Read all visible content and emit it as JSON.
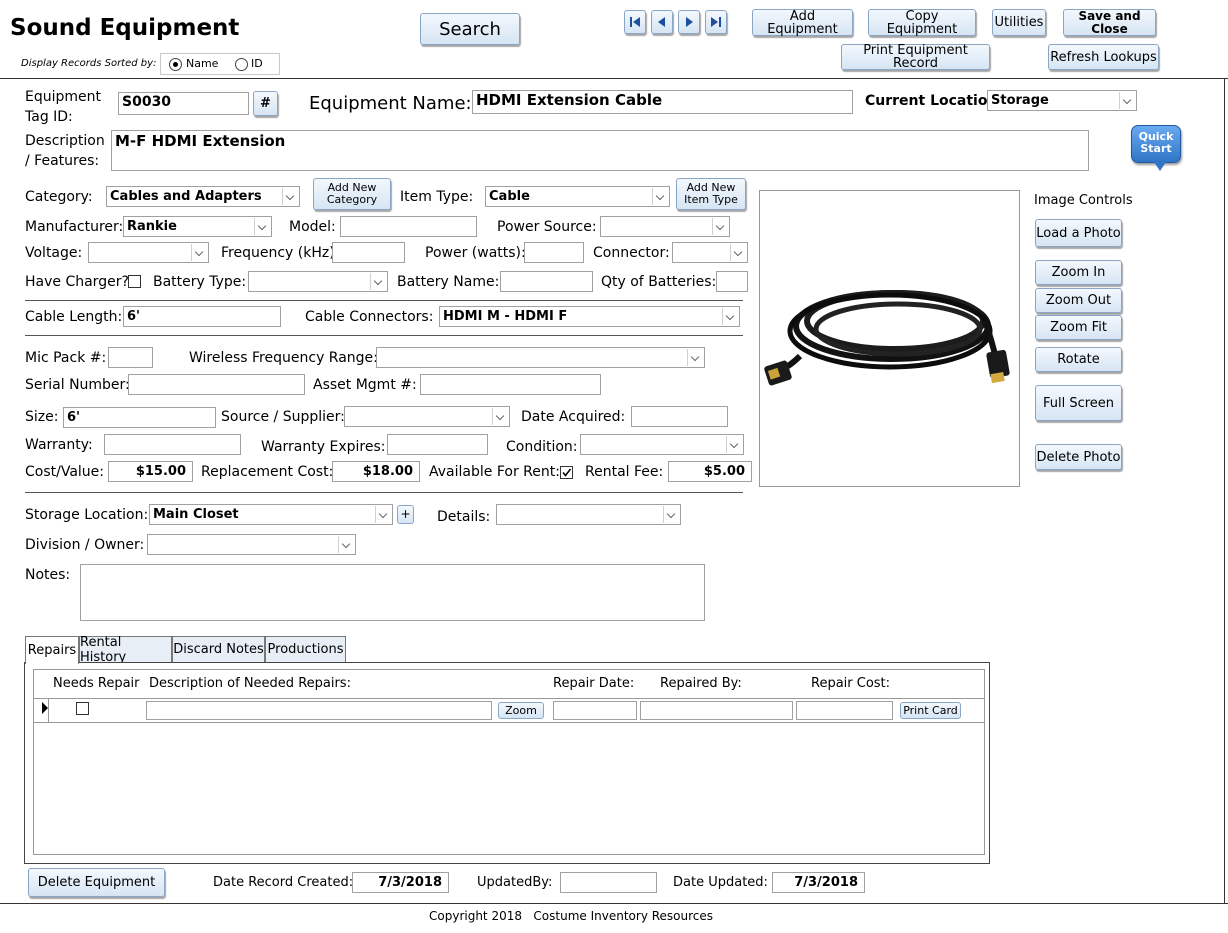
{
  "header": {
    "title": "Sound Equipment",
    "sort_label": "Display Records Sorted by:",
    "sort_options": [
      {
        "label": "Name",
        "selected": true
      },
      {
        "label": "ID",
        "selected": false
      }
    ],
    "search_label": "Search",
    "buttons": {
      "add_equipment": "Add Equipment",
      "copy_equipment": "Copy Equipment",
      "utilities": "Utilities",
      "save_close": "Save and Close",
      "print_record": "Print Equipment Record",
      "refresh_lookups": "Refresh Lookups"
    },
    "nav_icons": [
      "first-record-icon",
      "previous-record-icon",
      "next-record-icon",
      "last-record-icon"
    ]
  },
  "quick_start": {
    "line1": "Quick",
    "line2": "Start"
  },
  "record": {
    "tag_label_1": "Equipment",
    "tag_label_2": "Tag ID:",
    "tag_id": "S0030",
    "hash_label": "#",
    "name_label": "Equipment Name:",
    "name": "HDMI Extension Cable",
    "location_label": "Current Location:",
    "location": "Storage",
    "desc_label_1": "Description",
    "desc_label_2": "/ Features:",
    "description": "M-F HDMI Extension"
  },
  "details": {
    "category_label": "Category:",
    "category": "Cables and Adapters",
    "add_category_1": "Add New",
    "add_category_2": "Category",
    "item_type_label": "Item Type:",
    "item_type": "Cable",
    "add_item_type_1": "Add New",
    "add_item_type_2": "Item Type",
    "manufacturer_label": "Manufacturer:",
    "manufacturer": "Rankie",
    "model_label": "Model:",
    "model": "",
    "power_source_label": "Power Source:",
    "power_source": "",
    "voltage_label": "Voltage:",
    "voltage": "",
    "frequency_label": "Frequency (kHz):",
    "frequency": "",
    "power_label": "Power (watts):",
    "power": "",
    "connector_label": "Connector:",
    "connector": "",
    "charger_label": "Have Charger?",
    "battery_type_label": "Battery Type:",
    "battery_type": "",
    "battery_name_label": "Battery Name:",
    "battery_name": "",
    "qty_batteries_label": "Qty of Batteries:",
    "qty_batteries": "",
    "cable_length_label": "Cable Length:",
    "cable_length": "6'",
    "cable_connectors_label": "Cable Connectors:",
    "cable_connectors": "HDMI M - HDMI F",
    "mic_pack_label": "Mic Pack #:",
    "mic_pack": "",
    "wireless_label": "Wireless Frequency Range:",
    "wireless": "",
    "serial_label": "Serial Number:",
    "serial": "",
    "asset_label": "Asset Mgmt #:",
    "asset": "",
    "size_label": "Size:",
    "size": "6'",
    "supplier_label": "Source / Supplier:",
    "supplier": "",
    "date_acquired_label": "Date Acquired:",
    "date_acquired": "",
    "warranty_label": "Warranty:",
    "warranty": "",
    "warranty_expires_label": "Warranty Expires:",
    "warranty_expires": "",
    "condition_label": "Condition:",
    "condition": "",
    "cost_label": "Cost/Value:",
    "cost": "$15.00",
    "replacement_label": "Replacement Cost:",
    "replacement": "$18.00",
    "available_label": "Available For Rent:",
    "available": true,
    "rental_fee_label": "Rental Fee:",
    "rental_fee": "$5.00",
    "storage_label": "Storage Location:",
    "storage": "Main Closet",
    "plus_label": "+",
    "details_label": "Details:",
    "details_value": "",
    "division_label": "Division / Owner:",
    "division": "",
    "notes_label": "Notes:",
    "notes": ""
  },
  "image_controls": {
    "title": "Image Controls",
    "load": "Load a Photo",
    "zoom_in": "Zoom In",
    "zoom_out": "Zoom Out",
    "zoom_fit": "Zoom Fit",
    "rotate": "Rotate",
    "full_screen": "Full Screen",
    "delete": "Delete Photo"
  },
  "tabs": [
    {
      "label": "Repairs",
      "active": true
    },
    {
      "label": "Rental History",
      "active": false
    },
    {
      "label": "Discard Notes",
      "active": false
    },
    {
      "label": "Productions",
      "active": false
    }
  ],
  "repairs": {
    "columns": [
      "Needs Repair",
      "Description of Needed Repairs:",
      "Repair Date:",
      "Repaired By:",
      "Repair Cost:"
    ],
    "zoom_label": "Zoom",
    "print_card_label": "Print Card"
  },
  "footer": {
    "delete_label": "Delete Equipment",
    "created_label": "Date Record Created:",
    "created": "7/3/2018",
    "updated_by_label": "UpdatedBy:",
    "updated_by": "",
    "updated_label": "Date Updated:",
    "updated": "7/3/2018",
    "copyright": "Copyright 2018   Costume Inventory Resources"
  },
  "colors": {
    "button_border": "#8aa6c4",
    "quick_start": "#3d86d4"
  }
}
